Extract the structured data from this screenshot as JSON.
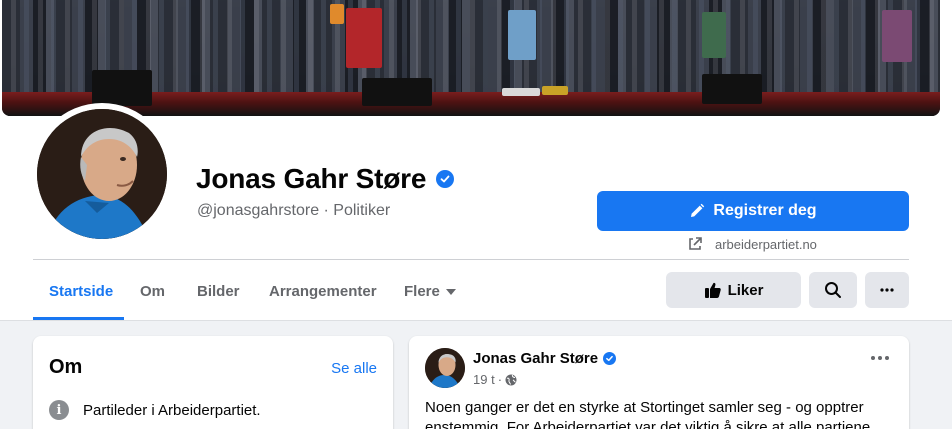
{
  "profile": {
    "name": "Jonas Gahr Støre",
    "subtitle": "@jonasgahrstore · Politiker",
    "verified_icon": "verified-badge-icon"
  },
  "actions": {
    "register_label": "Registrer deg",
    "website": "arbeiderpartiet.no",
    "like_label": "Liker"
  },
  "tabs": [
    {
      "label": "Startside",
      "active": true
    },
    {
      "label": "Om"
    },
    {
      "label": "Bilder"
    },
    {
      "label": "Arrangementer"
    },
    {
      "label": "Flere"
    }
  ],
  "about": {
    "title": "Om",
    "see_all": "Se alle",
    "items": [
      {
        "icon": "info-icon",
        "text": "Partileder i Arbeiderpartiet."
      }
    ]
  },
  "post": {
    "author": "Jonas Gahr Støre",
    "time": "19 t",
    "audience_icon": "globe-icon",
    "text": "Noen ganger er det en styrke at Stortinget samler seg - og opptrer enstemmig. For Arbeiderpartiet var det viktig å sikre at alle partiene"
  },
  "colors": {
    "accent": "#1877f2",
    "secondary_text": "#65676b",
    "button_gray": "#e4e6eb",
    "page_background": "#f0f2f5"
  }
}
